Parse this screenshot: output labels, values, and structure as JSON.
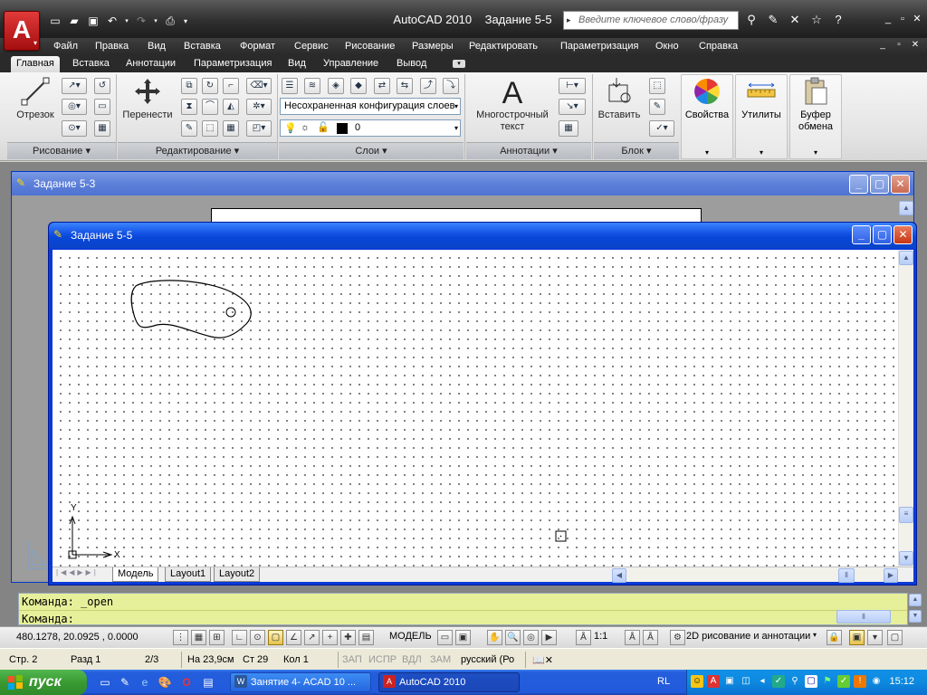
{
  "app": {
    "title": "AutoCAD 2010    Задание 5-5",
    "search_placeholder": "Введите ключевое слово/фразу"
  },
  "menu": [
    "Файл",
    "Правка",
    "Вид",
    "Вставка",
    "Формат",
    "Сервис",
    "Рисование",
    "Размеры",
    "Редактировать",
    "Параметризация",
    "Окно",
    "Справка"
  ],
  "ribbon_tabs": [
    "Главная",
    "Вставка",
    "Аннотации",
    "Параметризация",
    "Вид",
    "Управление",
    "Вывод"
  ],
  "ribbon": {
    "line_label": "Отрезок",
    "move_label": "Перенести",
    "layer_state": "Несохраненная конфигурация слоев",
    "current_layer": "0",
    "mtext_label": "Многострочный текст",
    "insert_label": "Вставить",
    "properties_label": "Свойства",
    "utilities_label": "Утилиты",
    "clipboard_label": "Буфер обмена",
    "panels": {
      "draw": "Рисование",
      "modify": "Редактирование",
      "layers": "Слои",
      "annotation": "Аннотации",
      "block": "Блок"
    }
  },
  "windows": {
    "back_title": "Задание 5-3",
    "front_title": "Задание 5-5"
  },
  "ucs": {
    "x_label": "X",
    "y_label": "Y"
  },
  "layout_tabs": [
    "Модель",
    "Layout1",
    "Layout2"
  ],
  "command": {
    "line1": "Команда: _open",
    "line2": "Команда:"
  },
  "status": {
    "coords": "480.1278, 20.0925 , 0.0000",
    "model": "МОДЕЛЬ",
    "scale": "1:1",
    "workspace": "2D рисование и аннотации"
  },
  "word_status": {
    "page": "Стр. 2",
    "section": "Разд 1",
    "pages": "2/3",
    "at": "На 23,9см",
    "line": "Ст 29",
    "col": "Кол 1",
    "rec": "ЗАП",
    "trk": "ИСПР",
    "ext": "ВДЛ",
    "ovr": "ЗАМ",
    "lang": "русский (Ро"
  },
  "taskbar": {
    "start": "пуск",
    "tasks": [
      "Занятие 4- ACAD 10 ...",
      "AutoCAD 2010"
    ],
    "lang": "RL",
    "clock": "15:12"
  }
}
